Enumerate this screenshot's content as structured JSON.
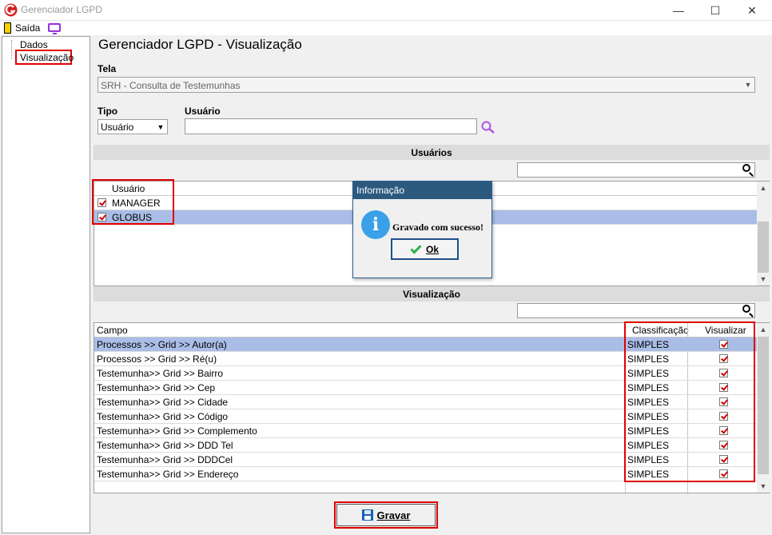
{
  "window": {
    "title": "Gerenciador LGPD",
    "controls": [
      "—",
      "☐",
      "✕"
    ]
  },
  "toolbar": {
    "exit_label": "Saída"
  },
  "tree": {
    "items": [
      {
        "label": "Dados"
      },
      {
        "label": "Visualização"
      }
    ]
  },
  "main": {
    "title": "Gerenciador LGPD - Visualização",
    "tela_label": "Tela",
    "tela_value": "SRH - Consulta de Testemunhas",
    "tipo_label": "Tipo",
    "tipo_value": "Usuário",
    "usuario_label": "Usuário",
    "usuario_value": ""
  },
  "usuarios": {
    "section_title": "Usuários",
    "column_header": "Usuário",
    "rows": [
      {
        "name": "MANAGER",
        "checked": true
      },
      {
        "name": "GLOBUS",
        "checked": true
      }
    ]
  },
  "visualizacao": {
    "section_title": "Visualização",
    "columns": [
      "Campo",
      "Classificação",
      "Visualizar"
    ],
    "rows": [
      {
        "campo": "Processos >> Grid >> Autor(a)",
        "class": "SIMPLES",
        "visualizar": true
      },
      {
        "campo": "Processos >> Grid >> Ré(u)",
        "class": "SIMPLES",
        "visualizar": true
      },
      {
        "campo": "Testemunha>> Grid >> Bairro",
        "class": "SIMPLES",
        "visualizar": true
      },
      {
        "campo": "Testemunha>> Grid >> Cep",
        "class": "SIMPLES",
        "visualizar": true
      },
      {
        "campo": "Testemunha>> Grid >> Cidade",
        "class": "SIMPLES",
        "visualizar": true
      },
      {
        "campo": "Testemunha>> Grid >> Código",
        "class": "SIMPLES",
        "visualizar": true
      },
      {
        "campo": "Testemunha>> Grid >> Complemento",
        "class": "SIMPLES",
        "visualizar": true
      },
      {
        "campo": "Testemunha>> Grid >> DDD Tel",
        "class": "SIMPLES",
        "visualizar": true
      },
      {
        "campo": "Testemunha>> Grid >> DDDCel",
        "class": "SIMPLES",
        "visualizar": true
      },
      {
        "campo": "Testemunha>> Grid >> Endereço",
        "class": "SIMPLES",
        "visualizar": true
      }
    ]
  },
  "dialog": {
    "title": "Informação",
    "message": "Gravado com sucesso!",
    "ok_label": "Ok"
  },
  "save_label": "Gravar"
}
